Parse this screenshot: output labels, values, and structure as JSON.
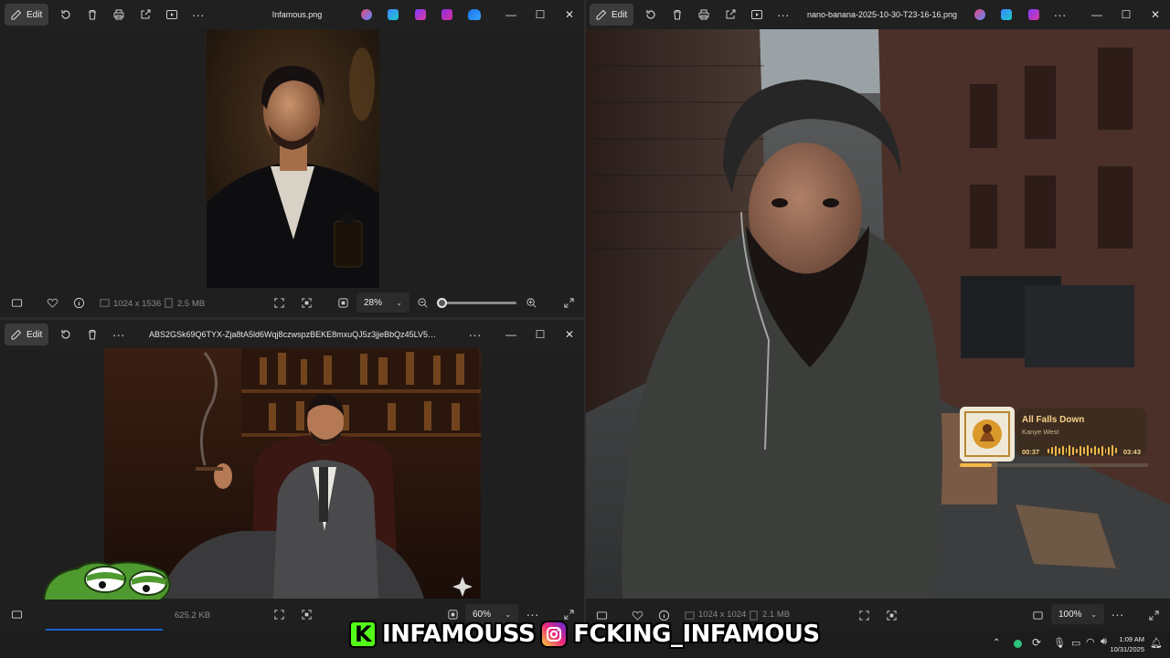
{
  "top_left": {
    "edit_label": "Edit",
    "title": "Infamous.png",
    "resolution": "1024 x 1536",
    "file_size": "2.5 MB",
    "zoom": "28%",
    "zoom_fraction": 0.03
  },
  "bottom_left": {
    "edit_label": "Edit",
    "title": "ABS2GSk69Q6TYX-Zja8tA5ld6Wqj8czwspzBEKE8mxuQJ5z3jjeBbQz45LV5Tlmqcb5bKLr...",
    "file_size": "625.2 KB",
    "zoom": "60%"
  },
  "right": {
    "edit_label": "Edit",
    "title": "nano-banana-2025-10-30-T23-16-16.png",
    "resolution": "1024 x 1024",
    "file_size": "2.1 MB",
    "zoom": "100%"
  },
  "music_widget": {
    "song": "All Falls Down",
    "artist": "Kanye West",
    "elapsed": "00:37",
    "total": "03:43",
    "progress_fraction": 0.17
  },
  "banner": {
    "kick_letter": "K",
    "kick_handle": "INFAMOUSS",
    "ig_handle": "FCKING_INFAMOUS"
  },
  "taskbar": {
    "time": "1:09 AM",
    "date": "10/31/2025"
  },
  "colors": {
    "accent_kick": "#53fc18",
    "music_gold": "#f0b948"
  }
}
